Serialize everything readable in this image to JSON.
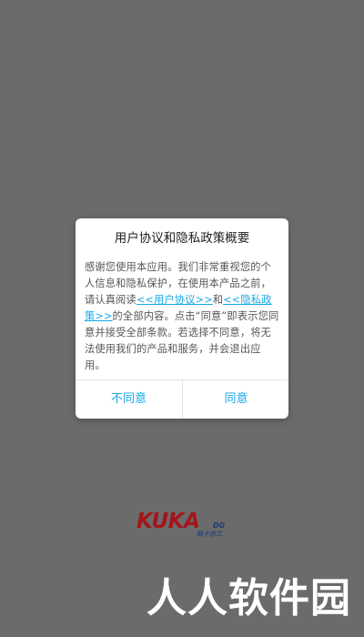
{
  "dialog": {
    "title": "用户协议和隐私政策概要",
    "body_text_1": "感谢您使用本应用。我们非常重视您的个人信息和隐私保护，在使用本产品之前，请认真阅读",
    "user_agreement_link": "<<用户协议>>",
    "and_text": "和",
    "privacy_policy_link": "<<隐私政策>>",
    "body_text_2": "的全部内容。点击“同意”即表示您同意并接受全部条款。若选择不同意，将无法使用我们的产品和服务，并会退出应用。",
    "disagree_label": "不同意",
    "agree_label": "同意"
  },
  "logo": {
    "brand": "KUKA",
    "dg": "DG",
    "sub": "酷卡德工"
  },
  "watermark": {
    "text": "人人软件园"
  },
  "colors": {
    "backdrop": "#6b6b6b",
    "accent": "#19a7e6",
    "logo_red": "#a3151a",
    "logo_blue": "#1b3a7a"
  }
}
